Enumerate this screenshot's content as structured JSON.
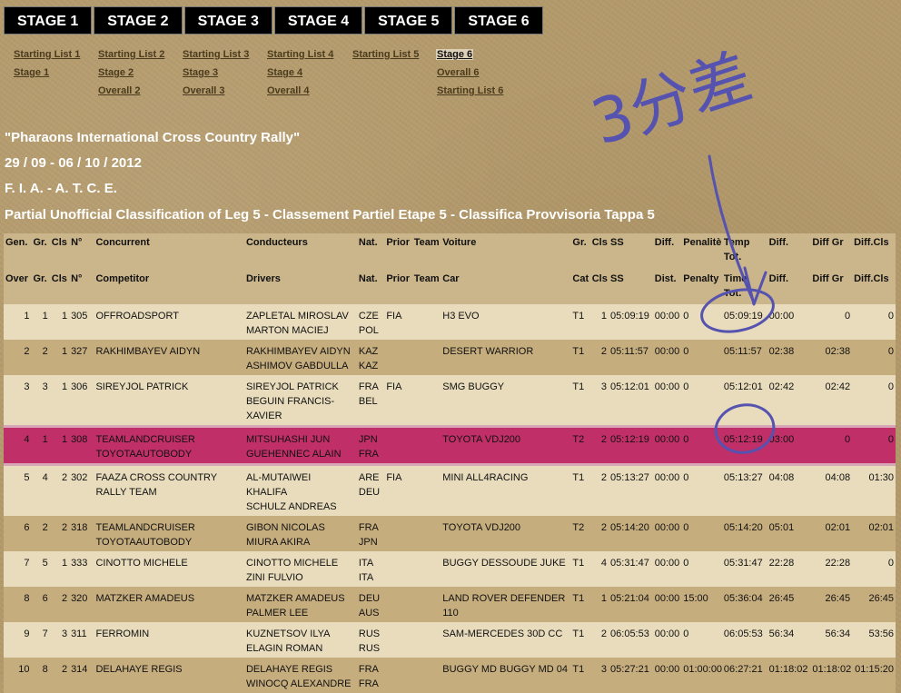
{
  "tabs": [
    "STAGE 1",
    "STAGE 2",
    "STAGE 3",
    "STAGE 4",
    "STAGE 5",
    "STAGE 6"
  ],
  "sublinks": {
    "col1": [
      "Starting List 1",
      "Stage 1"
    ],
    "col2": [
      "Starting List 2",
      "Stage 2",
      "Overall 2"
    ],
    "col3": [
      "Starting List 3",
      "Stage 3",
      "Overall 3"
    ],
    "col4": [
      "Starting List 4",
      "Stage 4",
      "Overall 4"
    ],
    "col5": [
      "Starting List 5"
    ],
    "col6": [
      "Stage 6",
      "Overall 6",
      "Starting List 6"
    ]
  },
  "event": {
    "title": "\"Pharaons International Cross Country Rally\"",
    "dates": "29 / 09 - 06 / 10 / 2012",
    "federation": "F. I. A. - A. T. C. E.",
    "classification": "Partial Unofficial Classification of Leg 5 - Classement Partiel Etape 5 - Classifica Provvisoria Tappa 5"
  },
  "table": {
    "header_fr": [
      "Gen.",
      "Gr.",
      "Cls",
      "N°",
      "Concurrent",
      "Conducteurs",
      "Nat.",
      "Prior",
      "Team",
      "Voiture",
      "Gr.",
      "Cls",
      "SS",
      "Diff.",
      "Penalitè",
      "Temp Tot.",
      "Diff.",
      "Diff Gr",
      "Diff.Cls"
    ],
    "header_en": [
      "Over",
      "Gr.",
      "Cls",
      "N°",
      "Competitor",
      "Drivers",
      "Nat.",
      "Prior",
      "Team",
      "Car",
      "Cat",
      "Cls",
      "SS",
      "Dist.",
      "Penalty",
      "Time Tot.",
      "Diff.",
      "Diff Gr",
      "Diff.Cls"
    ],
    "rows": [
      {
        "gen": "1",
        "gr": "1",
        "cls": "1",
        "no": "305",
        "competitor": [
          "OFFROADSPORT"
        ],
        "drivers": [
          "ZAPLETAL MIROSLAV",
          "MARTON MACIEJ"
        ],
        "nat": [
          "CZE",
          "POL"
        ],
        "prior": "FIA",
        "team": "",
        "car": [
          "H3 EVO"
        ],
        "cat": "T1",
        "cls2": "1",
        "ss": "05:09:19",
        "dist": "00:00",
        "pen": "0",
        "time": "05:09:19",
        "diff": "00:00",
        "diffgr": "0",
        "diffcls": "0",
        "style": "light"
      },
      {
        "gen": "2",
        "gr": "2",
        "cls": "1",
        "no": "327",
        "competitor": [
          "RAKHIMBAYEV AIDYN"
        ],
        "drivers": [
          "RAKHIMBAYEV AIDYN",
          "ASHIMOV GABDULLA"
        ],
        "nat": [
          "KAZ",
          "KAZ"
        ],
        "prior": "",
        "team": "",
        "car": [
          "DESERT WARRIOR"
        ],
        "cat": "T1",
        "cls2": "2",
        "ss": "05:11:57",
        "dist": "00:00",
        "pen": "0",
        "time": "05:11:57",
        "diff": "02:38",
        "diffgr": "02:38",
        "diffcls": "0",
        "style": "dark"
      },
      {
        "gen": "3",
        "gr": "3",
        "cls": "1",
        "no": "306",
        "competitor": [
          "SIREYJOL PATRICK"
        ],
        "drivers": [
          "SIREYJOL PATRICK",
          "BEGUIN FRANCIS-",
          "XAVIER"
        ],
        "nat": [
          "FRA",
          "BEL"
        ],
        "prior": "FIA",
        "team": "",
        "car": [
          "SMG BUGGY"
        ],
        "cat": "T1",
        "cls2": "3",
        "ss": "05:12:01",
        "dist": "00:00",
        "pen": "0",
        "time": "05:12:01",
        "diff": "02:42",
        "diffgr": "02:42",
        "diffcls": "0",
        "style": "light"
      },
      {
        "gen": "4",
        "gr": "1",
        "cls": "1",
        "no": "308",
        "competitor": [
          "TEAMLANDCRUISER",
          "TOYOTAAUTOBODY"
        ],
        "drivers": [
          "MITSUHASHI JUN",
          "GUEHENNEC ALAIN"
        ],
        "nat": [
          "JPN",
          "FRA"
        ],
        "prior": "",
        "team": "",
        "car": [
          "TOYOTA VDJ200"
        ],
        "cat": "T2",
        "cls2": "2",
        "ss": "05:12:19",
        "dist": "00:00",
        "pen": "0",
        "time": "05:12:19",
        "diff": "03:00",
        "diffgr": "0",
        "diffcls": "0",
        "style": "hl"
      },
      {
        "gen": "5",
        "gr": "4",
        "cls": "2",
        "no": "302",
        "competitor": [
          "FAAZA CROSS COUNTRY",
          "RALLY TEAM"
        ],
        "drivers": [
          "AL-MUTAIWEI",
          "KHALIFA",
          "SCHULZ ANDREAS"
        ],
        "nat": [
          "ARE",
          "DEU"
        ],
        "prior": "FIA",
        "team": "",
        "car": [
          "MINI ALL4RACING"
        ],
        "cat": "T1",
        "cls2": "2",
        "ss": "05:13:27",
        "dist": "00:00",
        "pen": "0",
        "time": "05:13:27",
        "diff": "04:08",
        "diffgr": "04:08",
        "diffcls": "01:30",
        "style": "light"
      },
      {
        "gen": "6",
        "gr": "2",
        "cls": "2",
        "no": "318",
        "competitor": [
          "TEAMLANDCRUISER",
          "TOYOTAAUTOBODY"
        ],
        "drivers": [
          "GIBON NICOLAS",
          "MIURA AKIRA"
        ],
        "nat": [
          "FRA",
          "JPN"
        ],
        "prior": "",
        "team": "",
        "car": [
          "TOYOTA VDJ200"
        ],
        "cat": "T2",
        "cls2": "2",
        "ss": "05:14:20",
        "dist": "00:00",
        "pen": "0",
        "time": "05:14:20",
        "diff": "05:01",
        "diffgr": "02:01",
        "diffcls": "02:01",
        "style": "dark"
      },
      {
        "gen": "7",
        "gr": "5",
        "cls": "1",
        "no": "333",
        "competitor": [
          "CINOTTO MICHELE"
        ],
        "drivers": [
          "CINOTTO MICHELE",
          "ZINI FULVIO"
        ],
        "nat": [
          "ITA",
          "ITA"
        ],
        "prior": "",
        "team": "",
        "car": [
          "BUGGY DESSOUDE JUKE"
        ],
        "cat": "T1",
        "cls2": "4",
        "ss": "05:31:47",
        "dist": "00:00",
        "pen": "0",
        "time": "05:31:47",
        "diff": "22:28",
        "diffgr": "22:28",
        "diffcls": "0",
        "style": "light"
      },
      {
        "gen": "8",
        "gr": "6",
        "cls": "2",
        "no": "320",
        "competitor": [
          "MATZKER AMADEUS"
        ],
        "drivers": [
          "MATZKER AMADEUS",
          "PALMER LEE"
        ],
        "nat": [
          "DEU",
          "AUS"
        ],
        "prior": "",
        "team": "",
        "car": [
          "LAND ROVER DEFENDER",
          "110"
        ],
        "cat": "T1",
        "cls2": "1",
        "ss": "05:21:04",
        "dist": "00:00",
        "pen": "15:00",
        "time": "05:36:04",
        "diff": "26:45",
        "diffgr": "26:45",
        "diffcls": "26:45",
        "style": "dark"
      },
      {
        "gen": "9",
        "gr": "7",
        "cls": "3",
        "no": "311",
        "competitor": [
          "FERROMIN"
        ],
        "drivers": [
          "KUZNETSOV ILYA",
          "ELAGIN ROMAN"
        ],
        "nat": [
          "RUS",
          "RUS"
        ],
        "prior": "",
        "team": "",
        "car": [
          "SAM-MERCEDES 30D CC"
        ],
        "cat": "T1",
        "cls2": "2",
        "ss": "06:05:53",
        "dist": "00:00",
        "pen": "0",
        "time": "06:05:53",
        "diff": "56:34",
        "diffgr": "56:34",
        "diffcls": "53:56",
        "style": "light"
      },
      {
        "gen": "10",
        "gr": "8",
        "cls": "2",
        "no": "314",
        "competitor": [
          "DELAHAYE REGIS"
        ],
        "drivers": [
          "DELAHAYE REGIS",
          "WINOCQ ALEXANDRE"
        ],
        "nat": [
          "FRA",
          "FRA"
        ],
        "prior": "",
        "team": "",
        "car": [
          "BUGGY MD BUGGY MD 04"
        ],
        "cat": "T1",
        "cls2": "3",
        "ss": "05:27:21",
        "dist": "00:00",
        "pen": "01:00:00",
        "time": "06:27:21",
        "diff": "01:18:02",
        "diffgr": "01:18:02",
        "diffcls": "01:15:20",
        "style": "dark"
      }
    ]
  },
  "annotation": {
    "note": "3分差",
    "ink_color": "#5552b0"
  }
}
